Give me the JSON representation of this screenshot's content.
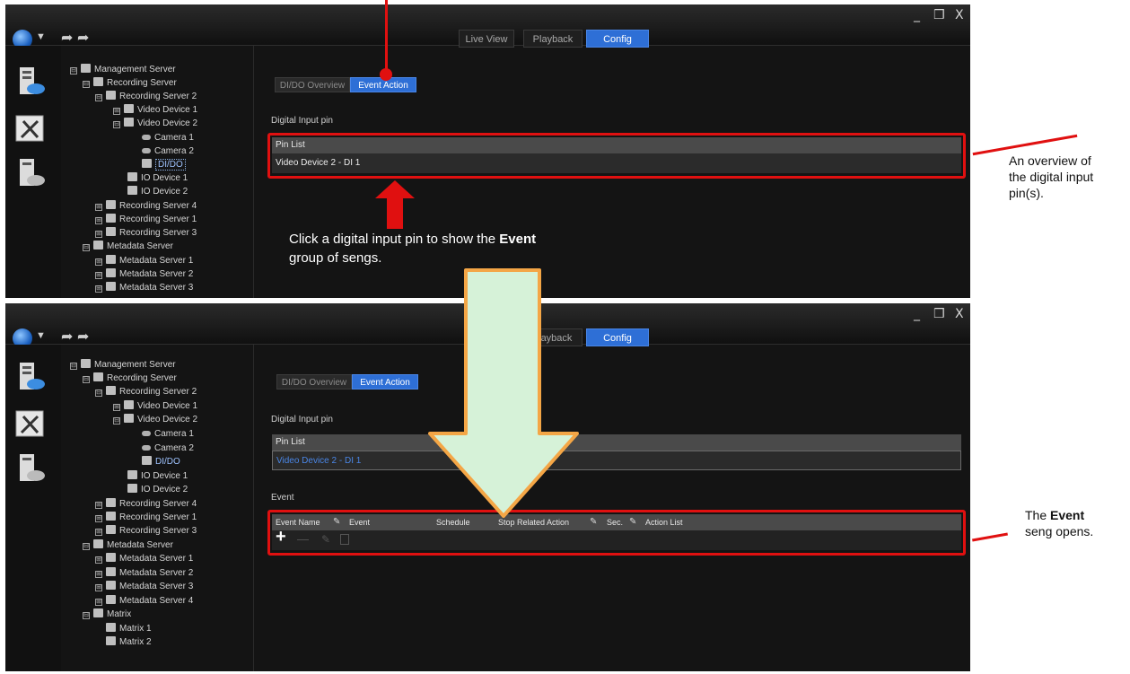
{
  "tabs": {
    "live_view": "Live View",
    "playback": "Playback",
    "playback_partial": "ayback",
    "config": "Config"
  },
  "window_controls": {
    "minimize": "_",
    "restore": "❒",
    "close": "X"
  },
  "subtabs": {
    "dido_overview": "DI/DO Overview",
    "event_action": "Event Action"
  },
  "tree_top": [
    {
      "label": "Management Server",
      "expander": "⊟",
      "icon": "server-group-icon"
    },
    {
      "label": "Recording Server",
      "expander": "⊟",
      "icon": "server-group-icon"
    },
    {
      "label": "Recording Server 2",
      "expander": "⊟",
      "icon": "server-icon"
    },
    {
      "label": "Video Device 1",
      "expander": "⊞",
      "icon": "device-icon"
    },
    {
      "label": "Video Device 2",
      "expander": "⊟",
      "icon": "device-icon"
    },
    {
      "label": "Camera 1",
      "icon": "camera-icon"
    },
    {
      "label": "Camera 2",
      "icon": "camera-icon"
    },
    {
      "label": "DI/DO",
      "icon": "io-icon"
    },
    {
      "label": "IO Device 1",
      "icon": "io-device-icon"
    },
    {
      "label": "IO Device 2",
      "icon": "io-device-icon"
    },
    {
      "label": "Recording Server 4",
      "expander": "⊞",
      "icon": "server-icon"
    },
    {
      "label": "Recording Server 1",
      "expander": "⊞",
      "icon": "server-icon"
    },
    {
      "label": "Recording Server 3",
      "expander": "⊞",
      "icon": "server-icon"
    },
    {
      "label": "Metadata Server",
      "expander": "⊟",
      "icon": "metadata-icon"
    },
    {
      "label": "Metadata Server 1",
      "expander": "⊞",
      "icon": "metadata-icon"
    },
    {
      "label": "Metadata Server 2",
      "expander": "⊞",
      "icon": "metadata-icon"
    },
    {
      "label": "Metadata Server 3",
      "expander": "⊞",
      "icon": "metadata-icon"
    }
  ],
  "tree_bottom_extra": [
    {
      "label": "Metadata Server 4",
      "expander": "⊞",
      "icon": "metadata-icon"
    },
    {
      "label": "Matrix",
      "expander": "⊟",
      "icon": "matrix-icon"
    },
    {
      "label": "Matrix 1",
      "icon": "matrix-icon"
    },
    {
      "label": "Matrix 2",
      "icon": "matrix-icon"
    }
  ],
  "digital_input": {
    "section_label": "Digital Input pin",
    "list_header": "Pin List",
    "row": "Video Device 2 - DI 1"
  },
  "event": {
    "section_label": "Event",
    "columns": [
      "Event Name",
      "Event",
      "Schedule",
      "Stop Related Action",
      "Sec.",
      "Action List"
    ],
    "toolbar": {
      "add": "+",
      "remove": "—"
    }
  },
  "annotations": {
    "overview_note": "An overview of\nthe digital input\npin(s).",
    "click_note_prefix": "Click a digital input pin to show the ",
    "click_note_bold": "Event",
    "click_note_suffix": "group of sengs.",
    "opens_prefix": "The ",
    "opens_bold": "Event",
    "opens_suffix": "seng opens."
  },
  "colors": {
    "accent": "#2e6fd6",
    "highlight_red": "#e01010",
    "arrow_green": "#d6f2d8",
    "arrow_orange": "#f4a646"
  }
}
